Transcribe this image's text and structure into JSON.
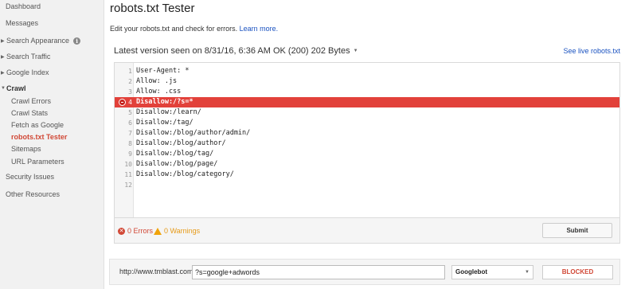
{
  "sidebar": {
    "items": [
      {
        "label": "Dashboard"
      },
      {
        "label": "Messages"
      },
      {
        "label": "Search Appearance",
        "has_caret": true,
        "has_info": true
      },
      {
        "label": "Search Traffic",
        "has_caret": true
      },
      {
        "label": "Google Index",
        "has_caret": true
      },
      {
        "label": "Crawl",
        "expanded": true
      },
      {
        "label": "Crawl Errors"
      },
      {
        "label": "Crawl Stats"
      },
      {
        "label": "Fetch as Google"
      },
      {
        "label": "robots.txt Tester",
        "active": true
      },
      {
        "label": "Sitemaps"
      },
      {
        "label": "URL Parameters"
      },
      {
        "label": "Security Issues"
      },
      {
        "label": "Other Resources"
      }
    ]
  },
  "page": {
    "title": "robots.txt Tester",
    "description": "Edit your robots.txt and check for errors.",
    "learn_more": "Learn more.",
    "version_text": "Latest version seen on 8/31/16, 6:36 AM OK (200) 202 Bytes",
    "see_live": "See live robots.txt"
  },
  "editor": {
    "lines": [
      {
        "n": "1",
        "text": "User-Agent: *"
      },
      {
        "n": "2",
        "text": "Allow: .js"
      },
      {
        "n": "3",
        "text": "Allow: .css"
      },
      {
        "n": "4",
        "text": "Disallow:/?s=*",
        "error": true
      },
      {
        "n": "5",
        "text": "Disallow:/learn/"
      },
      {
        "n": "6",
        "text": "Disallow:/tag/"
      },
      {
        "n": "7",
        "text": "Disallow:/blog/author/admin/"
      },
      {
        "n": "8",
        "text": "Disallow:/blog/author/"
      },
      {
        "n": "9",
        "text": "Disallow:/blog/tag/"
      },
      {
        "n": "10",
        "text": "Disallow:/blog/page/"
      },
      {
        "n": "11",
        "text": "Disallow:/blog/category/"
      },
      {
        "n": "12",
        "text": ""
      }
    ],
    "errors_label": "0 Errors",
    "warnings_label": "0 Warnings",
    "submit_label": "Submit"
  },
  "test": {
    "url_prefix": "http://www.tmblast.com/",
    "url_value": "?s=google+adwords",
    "user_agent": "Googlebot",
    "result": "BLOCKED"
  },
  "colors": {
    "error_line": "#e2413a",
    "active_nav": "#d14836",
    "link": "#1a52c0",
    "warning": "#f0a30a"
  }
}
